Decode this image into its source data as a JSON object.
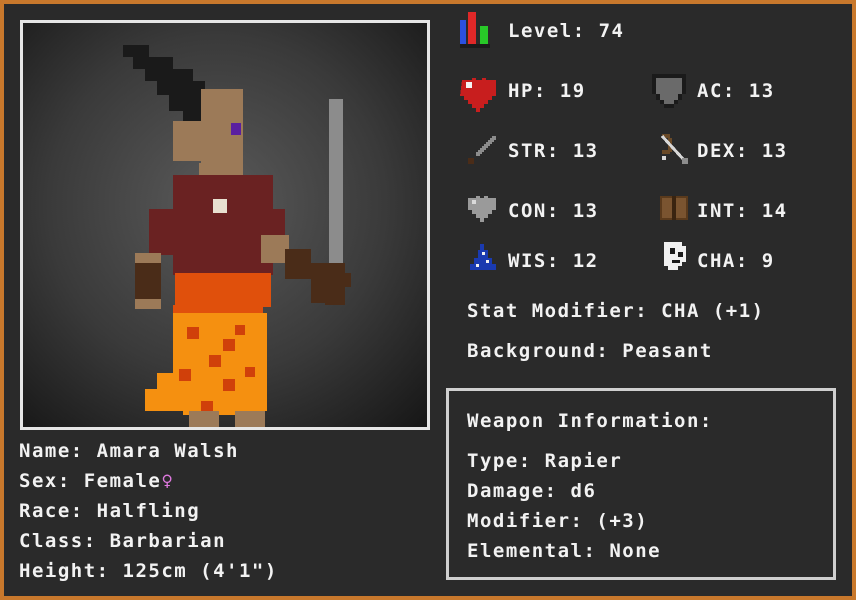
{
  "level": {
    "label": "Level:",
    "value": "74"
  },
  "stats": {
    "hp": {
      "label": "HP:",
      "value": "19"
    },
    "ac": {
      "label": "AC:",
      "value": "13"
    },
    "str": {
      "label": "STR:",
      "value": "13"
    },
    "dex": {
      "label": "DEX:",
      "value": "13"
    },
    "con": {
      "label": "CON:",
      "value": "13"
    },
    "int": {
      "label": "INT:",
      "value": "14"
    },
    "wis": {
      "label": "WIS:",
      "value": "12"
    },
    "cha": {
      "label": "CHA:",
      "value": "9"
    }
  },
  "stat_modifier": {
    "label": "Stat Modifier:",
    "value": "CHA (+1)"
  },
  "background": {
    "label": "Background:",
    "value": "Peasant"
  },
  "character": {
    "name": {
      "label": "Name:",
      "value": "Amara Walsh"
    },
    "sex": {
      "label": "Sex:",
      "value": "Female",
      "symbol": "♀"
    },
    "race": {
      "label": "Race:",
      "value": "Halfling"
    },
    "class": {
      "label": "Class:",
      "value": "Barbarian"
    },
    "height": {
      "label": "Height:",
      "value": "125cm (4'1\")"
    }
  },
  "weapon": {
    "title": "Weapon Information:",
    "type": {
      "label": "Type:",
      "value": "Rapier"
    },
    "damage": {
      "label": "Damage:",
      "value": "d6"
    },
    "modifier": {
      "label": "Modifier:",
      "value": "(+3)"
    },
    "elemental": {
      "label": "Elemental:",
      "value": "None"
    }
  },
  "colors": {
    "frame": "#c8782c",
    "panel": "#2a2a2a",
    "text": "#f2f2f2",
    "hp_red": "#c81e1e",
    "female_symbol": "#e07ae0",
    "level_bars": [
      "#2a50e0",
      "#e02828",
      "#28c828"
    ]
  },
  "icons": [
    "level-bars-icon",
    "heart-icon",
    "shield-icon",
    "sword-icon",
    "bow-icon",
    "grey-heart-icon",
    "book-icon",
    "wizard-hat-icon",
    "mask-icon",
    "female-symbol-icon"
  ]
}
